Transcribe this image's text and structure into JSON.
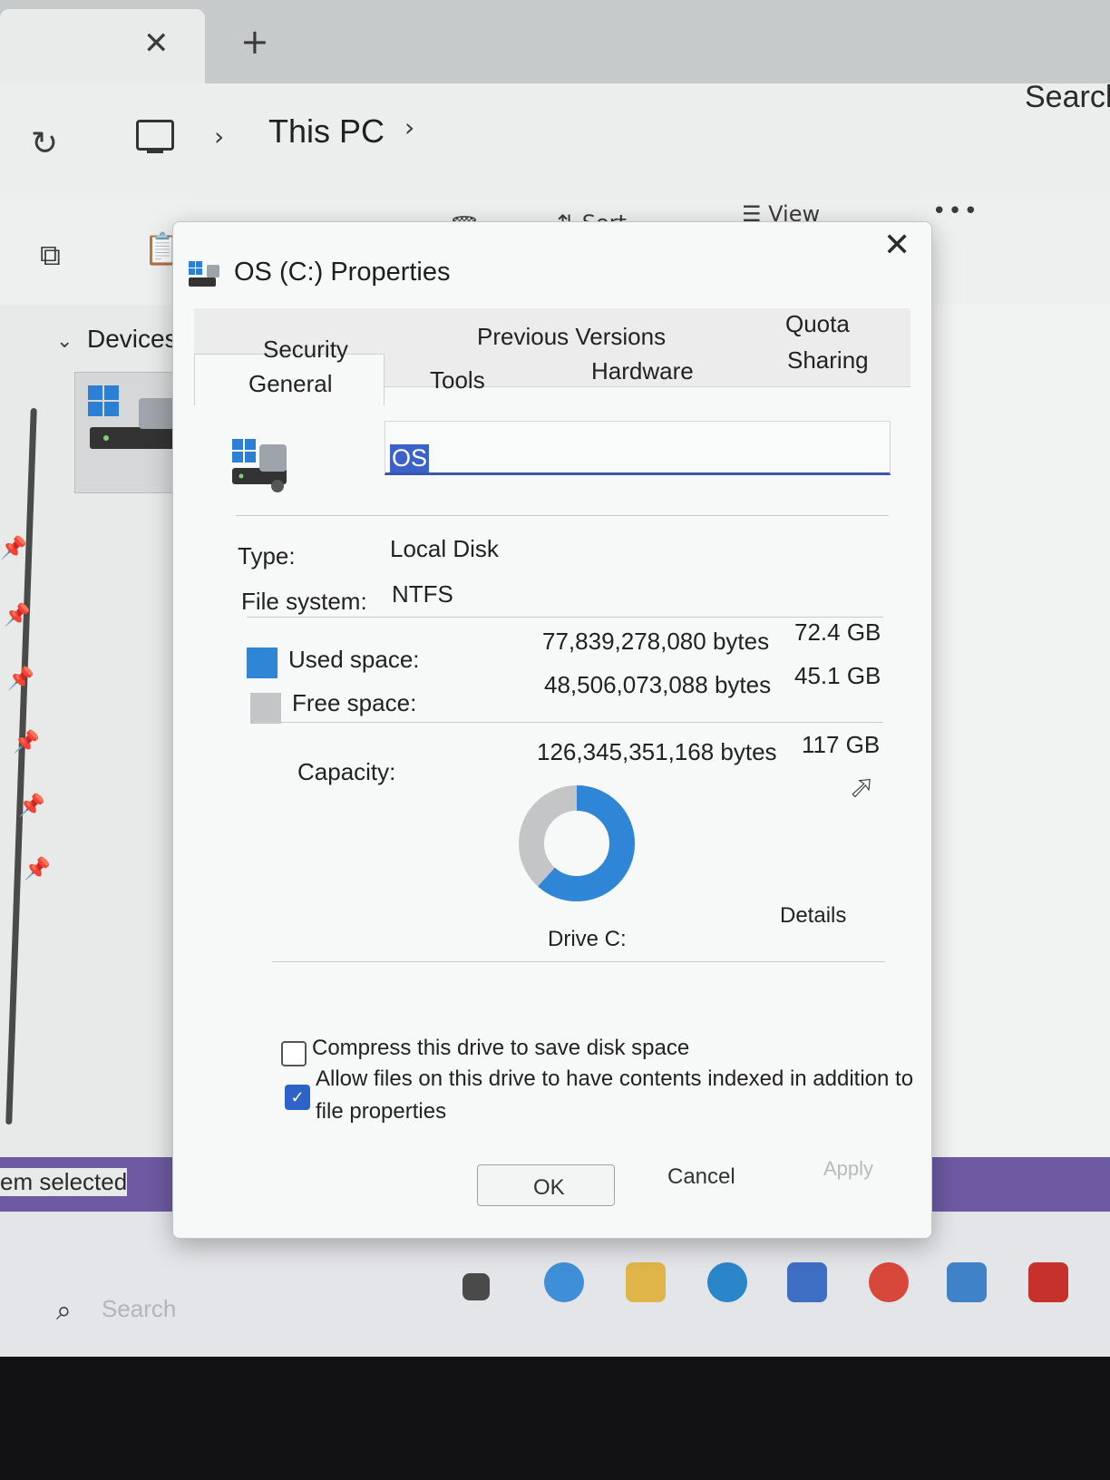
{
  "explorer": {
    "crumb_this_pc": "This PC",
    "search_placeholder": "Search",
    "sidebar_devices": "Devices",
    "status_items_selected": "em selected",
    "toolbar_sort": "Sort",
    "toolbar_view": "View",
    "taskbar_search": "Search"
  },
  "dialog": {
    "title": "OS (C:) Properties",
    "tabs_row1": [
      "Security",
      "Previous Versions",
      "Quota"
    ],
    "tabs_row2": [
      "General",
      "Tools",
      "Hardware",
      "Sharing"
    ],
    "active_tab": "General",
    "drive_name": "OS",
    "type_label": "Type:",
    "type_value": "Local Disk",
    "fs_label": "File system:",
    "fs_value": "NTFS",
    "used_label": "Used space:",
    "used_bytes": "77,839,278,080 bytes",
    "used_gb": "72.4 GB",
    "free_label": "Free space:",
    "free_bytes": "48,506,073,088 bytes",
    "free_gb": "45.1 GB",
    "capacity_label": "Capacity:",
    "capacity_bytes": "126,345,351,168 bytes",
    "capacity_gb": "117 GB",
    "used_fraction": 0.616,
    "drive_label": "Drive C:",
    "details_label": "Details",
    "compress_label": "Compress this drive to save disk space",
    "compress_checked": false,
    "index_label_line1": "Allow files on this drive to have contents indexed in addition to",
    "index_label_line2": "file properties",
    "index_checked": true,
    "ok_label": "OK",
    "cancel_label": "Cancel",
    "apply_label": "Apply"
  },
  "colors": {
    "used": "#2f86d6",
    "free": "#c3c5c7",
    "accent": "#3a57a8",
    "statusbar": "#6d5aa3"
  }
}
